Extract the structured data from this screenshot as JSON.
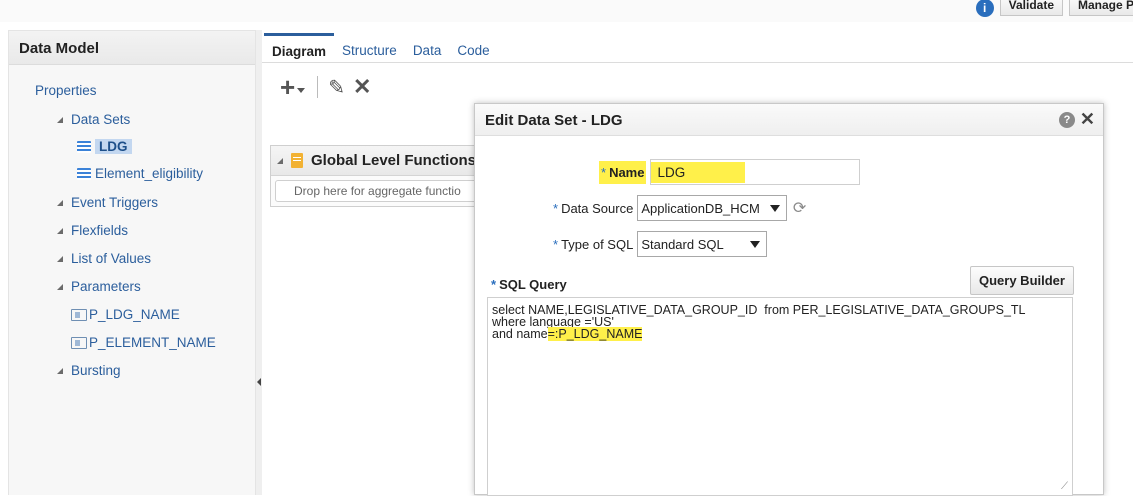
{
  "topbar": {
    "validate_label": "Validate",
    "manage_label": "Manage Pr",
    "info_icon": "info-icon"
  },
  "left_panel": {
    "title": "Data Model",
    "properties": "Properties",
    "data_sets": "Data Sets",
    "data_set_items": [
      "LDG",
      "Element_eligibility"
    ],
    "event_triggers": "Event Triggers",
    "flexfields": "Flexfields",
    "list_of_values": "List of Values",
    "parameters": "Parameters",
    "parameter_items": [
      "P_LDG_NAME",
      "P_ELEMENT_NAME"
    ],
    "bursting": "Bursting"
  },
  "tabs": [
    "Diagram",
    "Structure",
    "Data",
    "Code"
  ],
  "diagram": {
    "group_title": "Global Level Functions",
    "drop_hint": "Drop here for aggregate functio"
  },
  "dialog": {
    "title": "Edit Data Set - LDG",
    "name_label": "Name",
    "name_value": "LDG",
    "data_source_label": "Data Source",
    "data_source_value": "ApplicationDB_HCM",
    "sql_type_label": "Type of SQL",
    "sql_type_value": "Standard SQL",
    "sql_query_label": "SQL Query",
    "query_builder_label": "Query Builder",
    "sql_lines": [
      "select NAME,LEGISLATIVE_DATA_GROUP_ID  from PER_LEGISLATIVE_DATA_GROUPS_TL",
      "where language ='US'",
      "and name"
    ],
    "sql_highlight": "=:P_LDG_NAME",
    "required_mark": "*"
  },
  "colors": {
    "link_blue": "#2b5e9c",
    "highlight_yellow": "#fff04a",
    "required_blue": "#2a6ebd"
  }
}
